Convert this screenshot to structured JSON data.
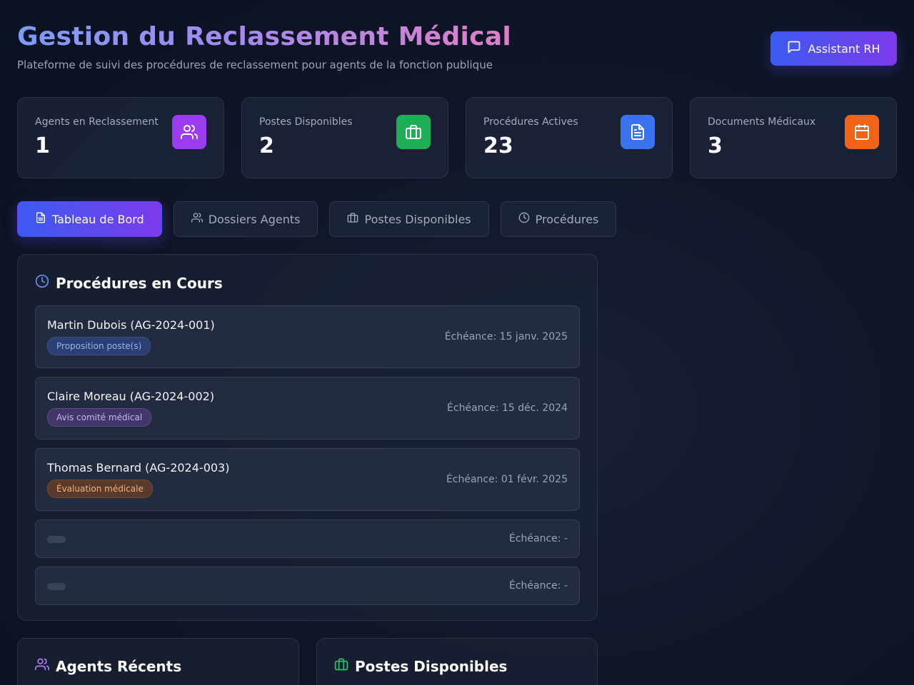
{
  "header": {
    "title": "Gestion du Reclassement Médical",
    "subtitle": "Plateforme de suivi des procédures de reclassement pour agents de la fonction publique",
    "assistant_label": "Assistant RH"
  },
  "stats": [
    {
      "label": "Agents en Reclassement",
      "value": "1",
      "icon": "users-icon",
      "color": "#9b3cf0"
    },
    {
      "label": "Postes Disponibles",
      "value": "2",
      "icon": "briefcase-icon",
      "color": "#1fae55"
    },
    {
      "label": "Procédures Actives",
      "value": "23",
      "icon": "document-icon",
      "color": "#3b73ee"
    },
    {
      "label": "Documents Médicaux",
      "value": "3",
      "icon": "calendar-icon",
      "color": "#f0641a"
    }
  ],
  "tabs": [
    {
      "label": "Tableau de Bord",
      "icon": "document-icon",
      "active": true
    },
    {
      "label": "Dossiers Agents",
      "icon": "users-icon",
      "active": false
    },
    {
      "label": "Postes Disponibles",
      "icon": "briefcase-icon",
      "active": false
    },
    {
      "label": "Procédures",
      "icon": "clock-icon",
      "active": false
    }
  ],
  "procedures": {
    "title": "Procédures en Cours",
    "items": [
      {
        "name": "Martin Dubois (AG-2024-001)",
        "status": "Proposition poste(s)",
        "status_color": "blue",
        "deadline": "Échéance: 15 janv. 2025"
      },
      {
        "name": "Claire Moreau (AG-2024-002)",
        "status": "Avis comité médical",
        "status_color": "purple",
        "deadline": "Échéance: 15 déc. 2024"
      },
      {
        "name": "Thomas Bernard (AG-2024-003)",
        "status": "Évaluation médicale",
        "status_color": "orange",
        "deadline": "Échéance: 01 févr. 2025"
      },
      {
        "name": "",
        "status": "",
        "status_color": "empty",
        "deadline": "Échéance: -"
      },
      {
        "name": "",
        "status": "",
        "status_color": "empty",
        "deadline": "Échéance: -"
      }
    ]
  },
  "agents_panel": {
    "title": "Agents Récents"
  },
  "postes_panel": {
    "title": "Postes Disponibles"
  }
}
